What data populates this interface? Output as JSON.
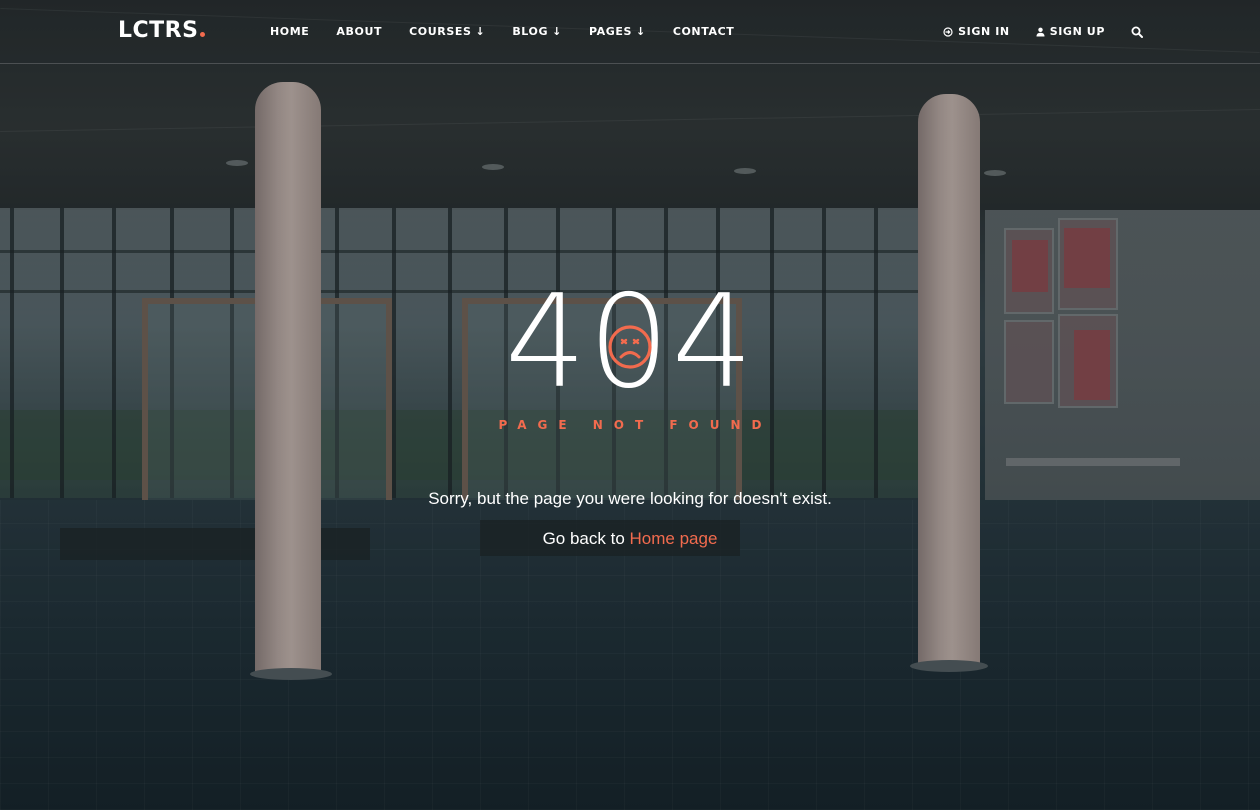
{
  "brand": {
    "logo_text": "LCTRS",
    "accent": "#f26b4e"
  },
  "nav": {
    "items": [
      {
        "label": "HOME",
        "dropdown": false
      },
      {
        "label": "ABOUT",
        "dropdown": false
      },
      {
        "label": "COURSES",
        "dropdown": true
      },
      {
        "label": "BLOG",
        "dropdown": true
      },
      {
        "label": "PAGES",
        "dropdown": true
      },
      {
        "label": "CONTACT",
        "dropdown": false
      }
    ],
    "sign_in": "SIGN IN",
    "sign_up": "SIGN UP",
    "search_icon": "search-icon"
  },
  "error": {
    "code": "404",
    "subtitle": "PAGE NOT FOUND",
    "face_icon": "sad-face-icon",
    "message": "Sorry, but the page you were looking for doesn't exist.",
    "go_back_prefix": "Go back to",
    "home_link": "Home page"
  }
}
